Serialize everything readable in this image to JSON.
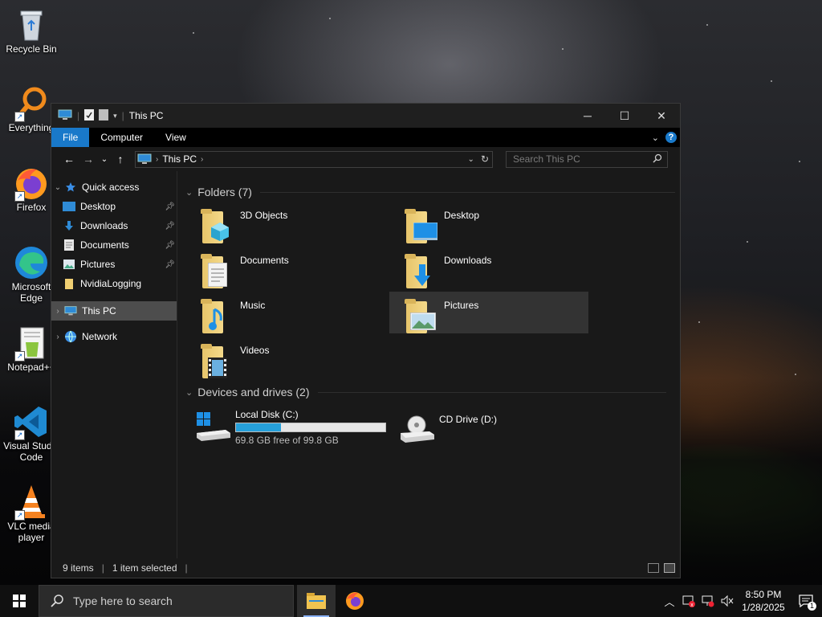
{
  "desktop": {
    "icons": [
      {
        "label": "Recycle Bin",
        "icon": "recycle-bin-icon"
      },
      {
        "label": "Everything",
        "icon": "everything-search-icon"
      },
      {
        "label": "Firefox",
        "icon": "firefox-icon"
      },
      {
        "label": "Microsoft Edge",
        "icon": "edge-icon"
      },
      {
        "label": "Notepad++",
        "icon": "notepad-plus-plus-icon"
      },
      {
        "label": "Visual Studio Code",
        "icon": "vscode-icon"
      },
      {
        "label": "VLC media player",
        "icon": "vlc-icon"
      }
    ]
  },
  "window": {
    "title": "This PC",
    "ribbon_tabs": [
      "File",
      "Computer",
      "View"
    ],
    "address": {
      "location": "This PC"
    },
    "search": {
      "placeholder": "Search This PC"
    },
    "nav_pane": {
      "quick_access": "Quick access",
      "items": [
        "Desktop",
        "Downloads",
        "Documents",
        "Pictures",
        "NvidiaLogging"
      ],
      "this_pc": "This PC",
      "network": "Network"
    },
    "folders": {
      "header": "Folders (7)",
      "items": [
        "3D Objects",
        "Desktop",
        "Documents",
        "Downloads",
        "Music",
        "Pictures",
        "Videos"
      ]
    },
    "drives": {
      "header": "Devices and drives (2)",
      "items": [
        {
          "name": "Local Disk (C:)",
          "free_text": "69.8 GB free of 99.8 GB",
          "used_fraction": 0.3
        },
        {
          "name": "CD Drive (D:)"
        }
      ]
    },
    "status": {
      "item_count": "9 items",
      "selection": "1 item selected"
    }
  },
  "taskbar": {
    "search_placeholder": "Type here to search",
    "time": "8:50 PM",
    "date": "1/28/2025",
    "notification_count": "1"
  },
  "colors": {
    "accent": "#1979ca",
    "drive_bar": "#26a0da",
    "selection": "#333333"
  }
}
